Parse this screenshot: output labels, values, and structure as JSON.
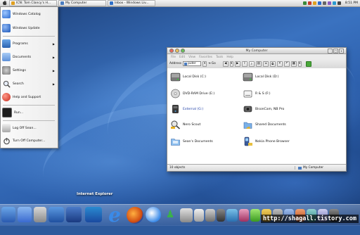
{
  "menubar": {
    "tabs": [
      {
        "label": "ICN: Tom Clancy's H...",
        "color": "#e0a020"
      },
      {
        "label": "My Computer",
        "color": "#4a7cc0"
      },
      {
        "label": "Inbox - Windows Liv...",
        "color": "#3070c8"
      }
    ],
    "clock": "8:51 PM"
  },
  "start_menu": {
    "items": [
      {
        "label": "Windows Catalog",
        "icon": "catalog-icon",
        "color": "#2a6ad0"
      },
      {
        "label": "Windows Update",
        "icon": "update-icon",
        "color": "#1c57b8"
      },
      {
        "label": "Programs",
        "icon": "programs-icon",
        "color": "#3a78c8",
        "submenu": true
      },
      {
        "label": "Documents",
        "icon": "documents-icon",
        "color": "#6aa0e0",
        "submenu": true
      },
      {
        "label": "Settings",
        "icon": "settings-icon",
        "color": "#8a8a8a",
        "submenu": true
      },
      {
        "label": "Search",
        "icon": "search-icon",
        "color": "#6a6a6a",
        "submenu": true
      },
      {
        "label": "Help and Support",
        "icon": "help-icon",
        "color": "#d23a2a"
      },
      {
        "label": "Run...",
        "icon": "run-icon",
        "color": "#222222"
      },
      {
        "label": "Log Off Sean...",
        "icon": "logoff-icon",
        "color": "#9a9a9a"
      },
      {
        "label": "Turn Off Computer...",
        "icon": "power-icon",
        "color": "#5a5a5a"
      }
    ]
  },
  "window": {
    "title": "My Computer",
    "menu": [
      "File",
      "Edit",
      "View",
      "Favorites",
      "Tools",
      "Help"
    ],
    "address_label": "Address",
    "address_value": "puter",
    "go_label": "Go",
    "items": [
      {
        "label": "Local Disk (C:)",
        "icon": "hard-disk-icon"
      },
      {
        "label": "Local Disk (D:)",
        "icon": "hard-disk-icon"
      },
      {
        "label": "DVD-RAM Drive (E:)",
        "icon": "dvd-drive-icon"
      },
      {
        "label": "R & S (F:)",
        "icon": "removable-drive-icon"
      },
      {
        "label": "External (G:)",
        "icon": "external-drive-icon"
      },
      {
        "label": "BisonCam, NB Pro",
        "icon": "webcam-icon"
      },
      {
        "label": "Nero Scout",
        "icon": "nero-scout-icon"
      },
      {
        "label": "Shared Documents",
        "icon": "shared-folder-icon"
      },
      {
        "label": "Sean's Documents",
        "icon": "folder-icon"
      },
      {
        "label": "Nokia Phone Browser",
        "icon": "phone-browser-icon"
      }
    ],
    "status_left": "10 objects",
    "status_right": "My Computer"
  },
  "dock": {
    "hover_label": "Internet Explorer"
  },
  "watermark": "http://shagall.tistory.com"
}
